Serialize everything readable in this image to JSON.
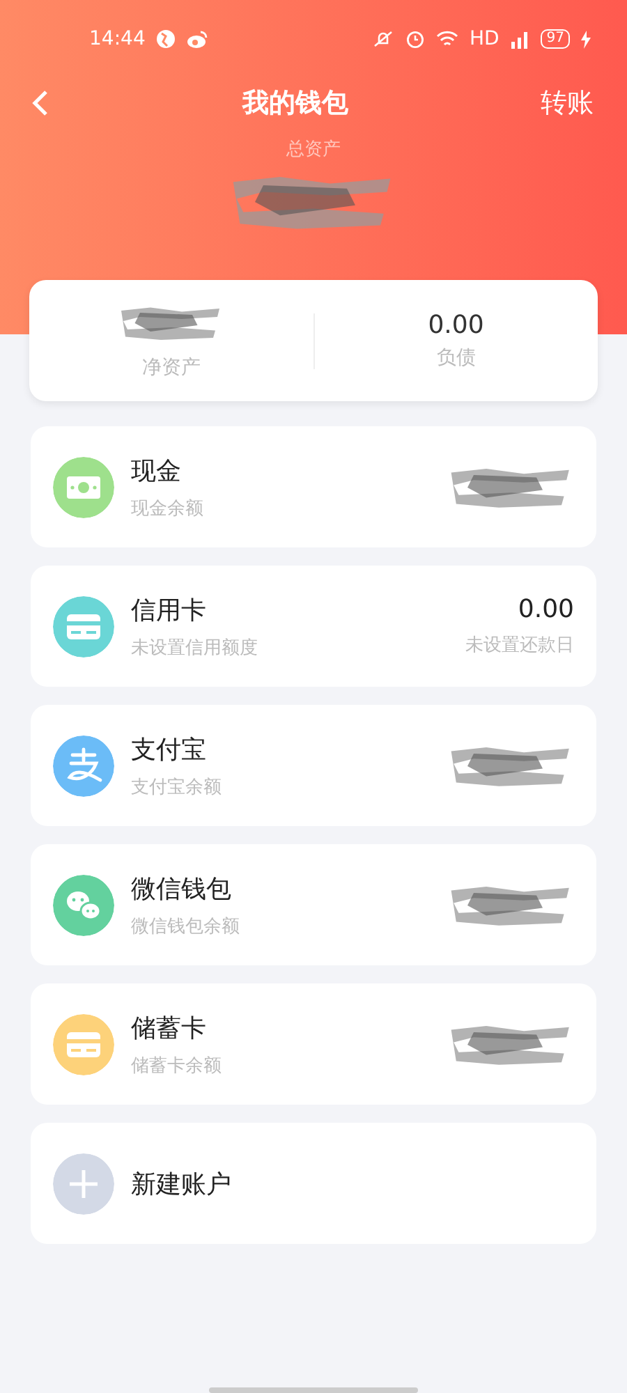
{
  "status_bar": {
    "time": "14:44",
    "network": "HD",
    "battery": "97"
  },
  "header": {
    "title": "我的钱包",
    "action": "转账",
    "total_label": "总资产",
    "total_redacted": true
  },
  "summary": [
    {
      "label": "净资产",
      "redacted": true
    },
    {
      "label": "负债",
      "value": "0.00",
      "redacted": false
    }
  ],
  "accounts": [
    {
      "kind": "cash",
      "name": "现金",
      "sub": "现金余额",
      "redacted": true,
      "color": "#9ee08c"
    },
    {
      "kind": "credit",
      "name": "信用卡",
      "sub": "未设置信用额度",
      "amount": "0.00",
      "note": "未设置还款日",
      "redacted": false,
      "color": "#6ad6d6"
    },
    {
      "kind": "alipay",
      "name": "支付宝",
      "sub": "支付宝余额",
      "redacted": true,
      "color": "#6bbcf7"
    },
    {
      "kind": "wechat",
      "name": "微信钱包",
      "sub": "微信钱包余额",
      "redacted": true,
      "color": "#63d19e"
    },
    {
      "kind": "debit",
      "name": "储蓄卡",
      "sub": "储蓄卡余额",
      "redacted": true,
      "color": "#fdd27a"
    }
  ],
  "new_account": {
    "label": "新建账户"
  }
}
